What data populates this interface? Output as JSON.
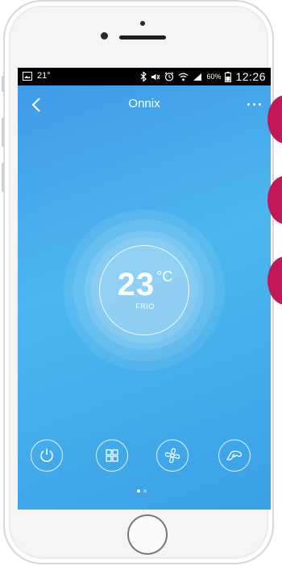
{
  "status_bar": {
    "temperature": "21°",
    "battery_percent": "60%",
    "time": "12:26",
    "icons": [
      "gallery-icon",
      "bluetooth-icon",
      "mute-icon",
      "alarm-icon",
      "wifi-icon",
      "signal-icon",
      "battery-icon"
    ]
  },
  "app_bar": {
    "title": "Onnix",
    "back_icon": "back-arrow-icon",
    "menu_icon": "more-options-icon"
  },
  "thermostat": {
    "temperature": "23",
    "unit": "°C",
    "mode": "FRIO"
  },
  "controls": [
    {
      "icon": "power-icon"
    },
    {
      "icon": "mode-grid-icon"
    },
    {
      "icon": "fan-icon"
    },
    {
      "icon": "swing-icon"
    }
  ],
  "pager": {
    "pages": 2,
    "active": 1
  },
  "colors": {
    "screen_top": "#3f98e8",
    "screen_mid": "#4cb7ee",
    "marker": "#c2185b",
    "status_bar": "#000000"
  }
}
